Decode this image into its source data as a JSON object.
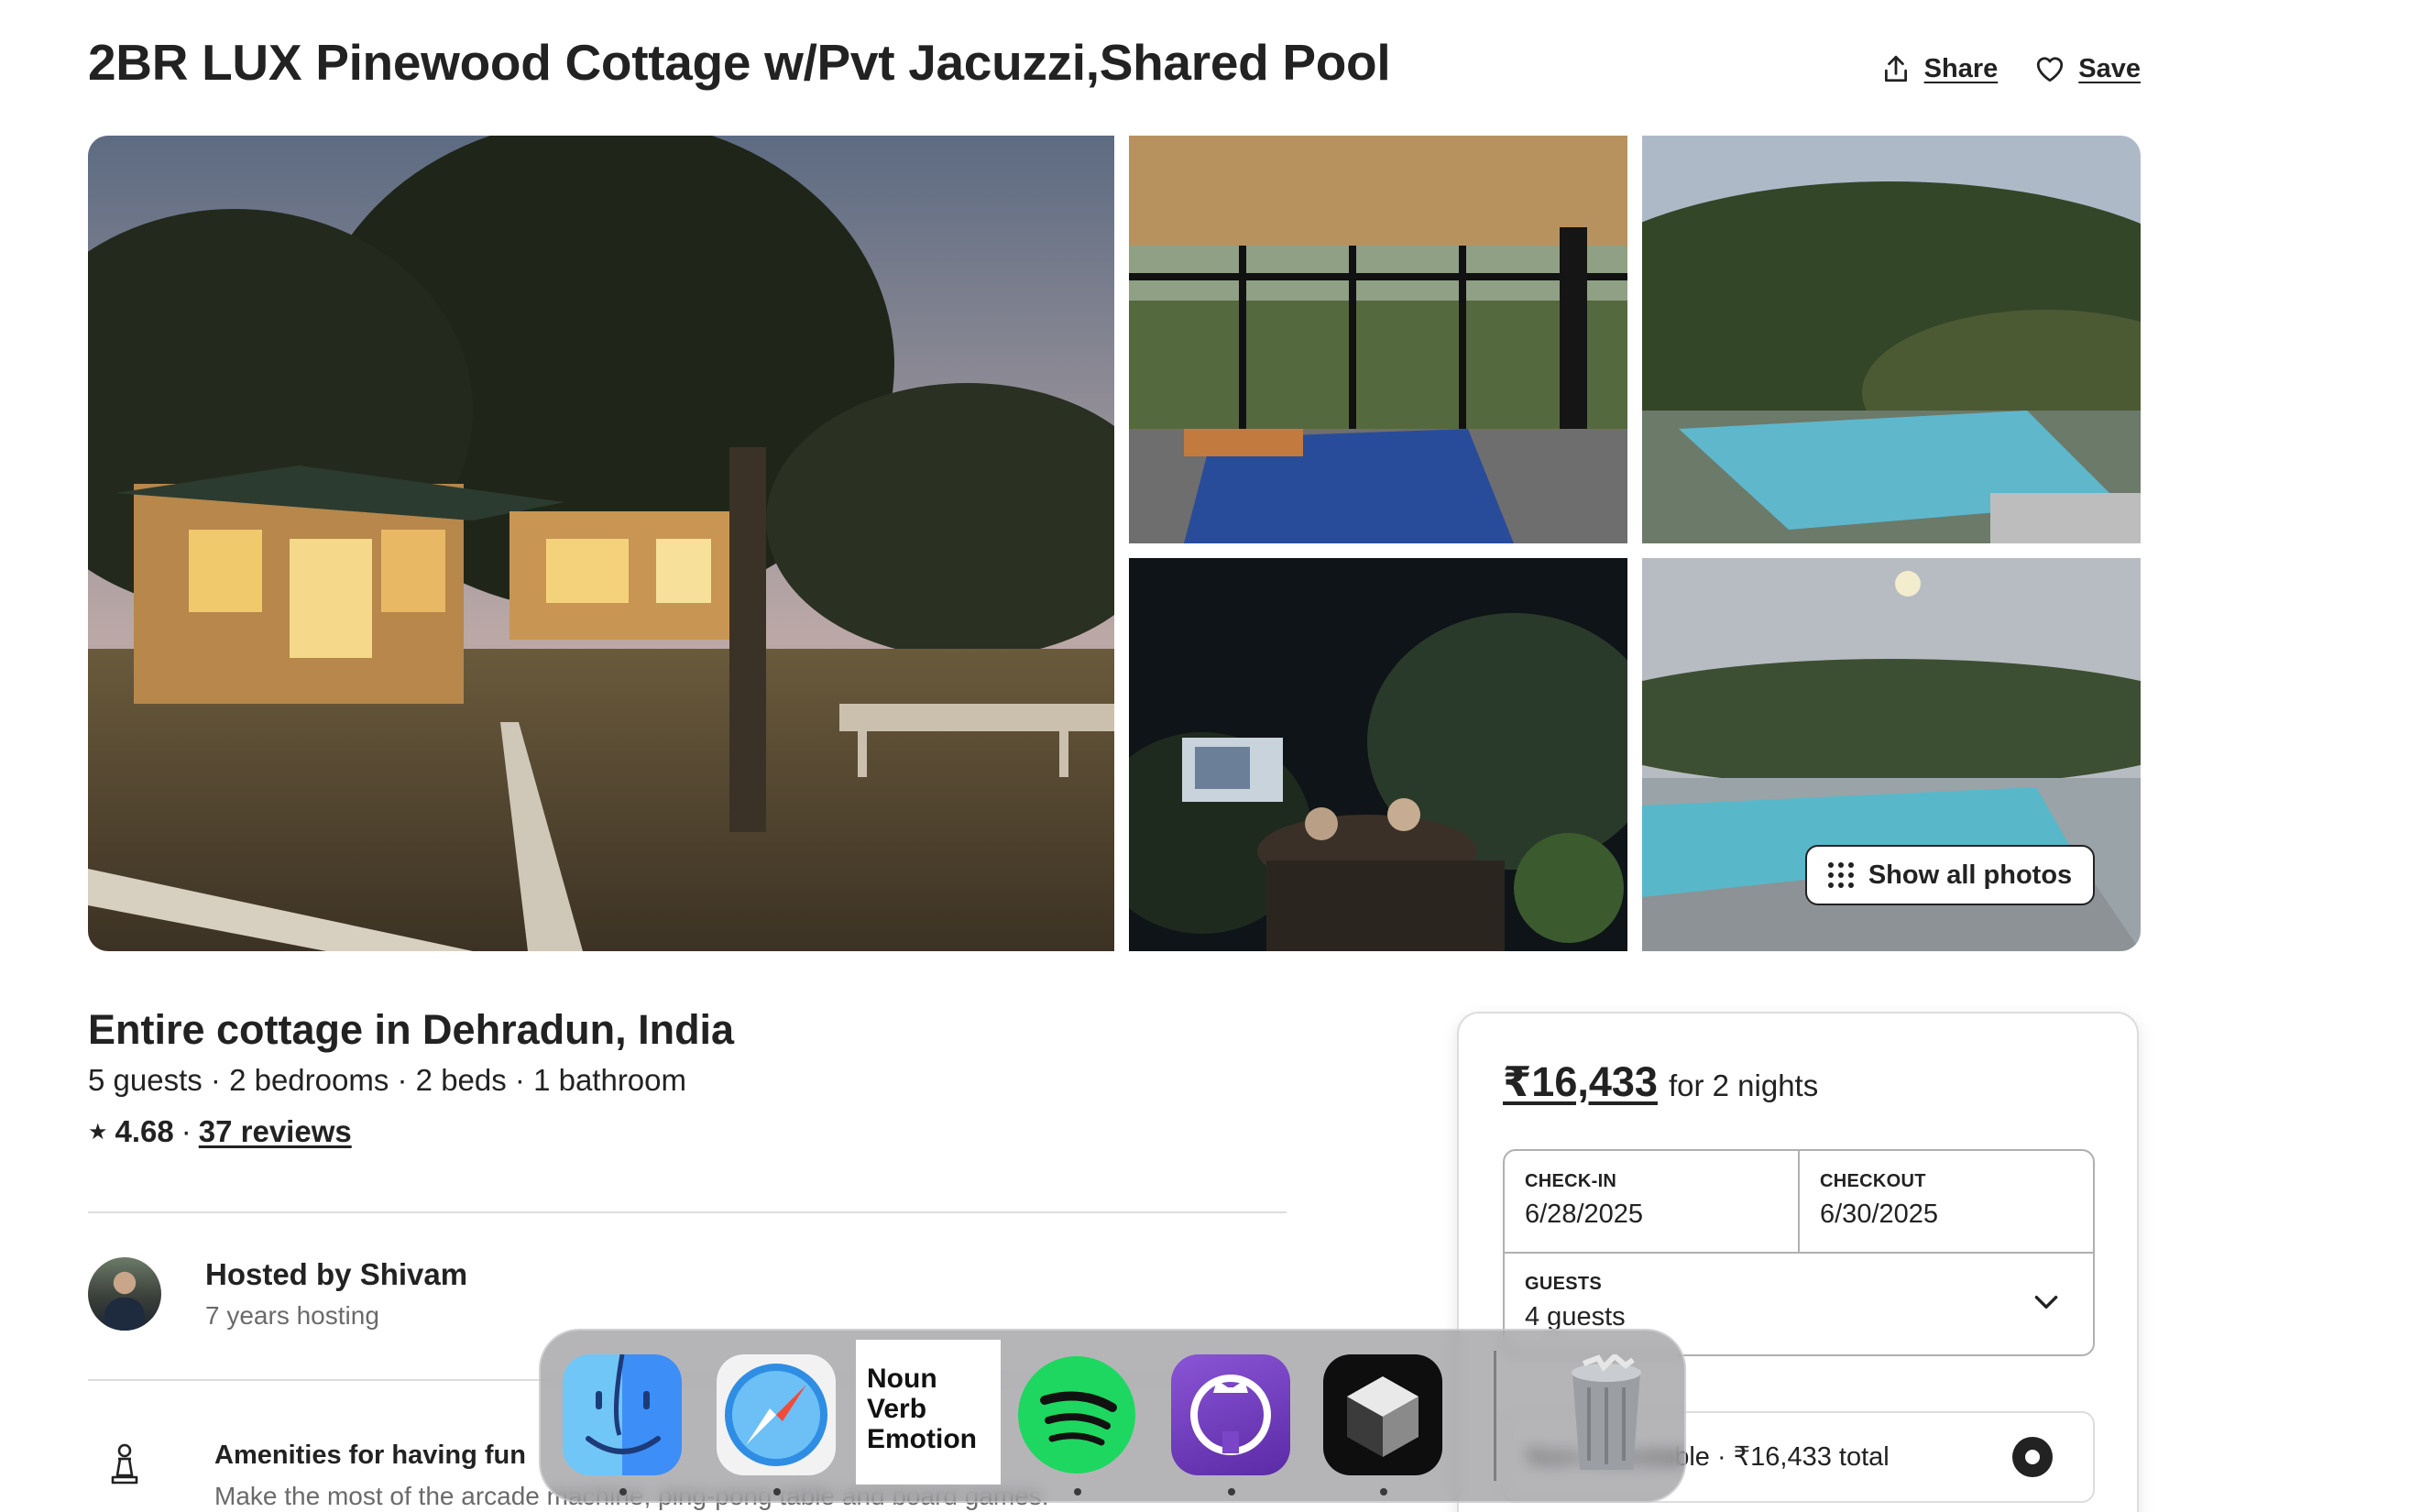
{
  "listing": {
    "title": "2BR LUX Pinewood Cottage w/Pvt Jacuzzi,Shared Pool",
    "share_label": "Share",
    "save_label": "Save"
  },
  "gallery": {
    "show_all_label": "Show all photos"
  },
  "details": {
    "subtitle": "Entire cottage in Dehradun, India",
    "specs": "5 guests · 2 bedrooms · 2 beds · 1 bathroom",
    "rating_star": "★",
    "rating_value": "4.68",
    "rating_sep": "·",
    "reviews_label": "37 reviews"
  },
  "host": {
    "name": "Hosted by Shivam",
    "years": "7 years hosting"
  },
  "amenity": {
    "title": "Amenities for having fun",
    "description": "Make the most of the arcade machine, ping-pong table and board games."
  },
  "booking": {
    "price": "₹16,433",
    "price_suffix": "for 2 nights",
    "checkin_label": "CHECK-IN",
    "checkin_value": "6/28/2025",
    "checkout_label": "CHECKOUT",
    "checkout_value": "6/30/2025",
    "guests_label": "GUESTS",
    "guests_value": "4 guests",
    "option_text": "Non-refundable · ₹16,433 total"
  },
  "dock": {
    "noun_app_text": [
      "Noun",
      "Verb",
      "Emotion"
    ],
    "apps": [
      "Finder",
      "Safari",
      "Noun Verb Emotion",
      "Spotify",
      "GitHub Desktop",
      "Cursor",
      "Trash"
    ]
  },
  "colors": {
    "text": "#222222",
    "muted": "#6a6a6a",
    "border": "#dddddd"
  }
}
